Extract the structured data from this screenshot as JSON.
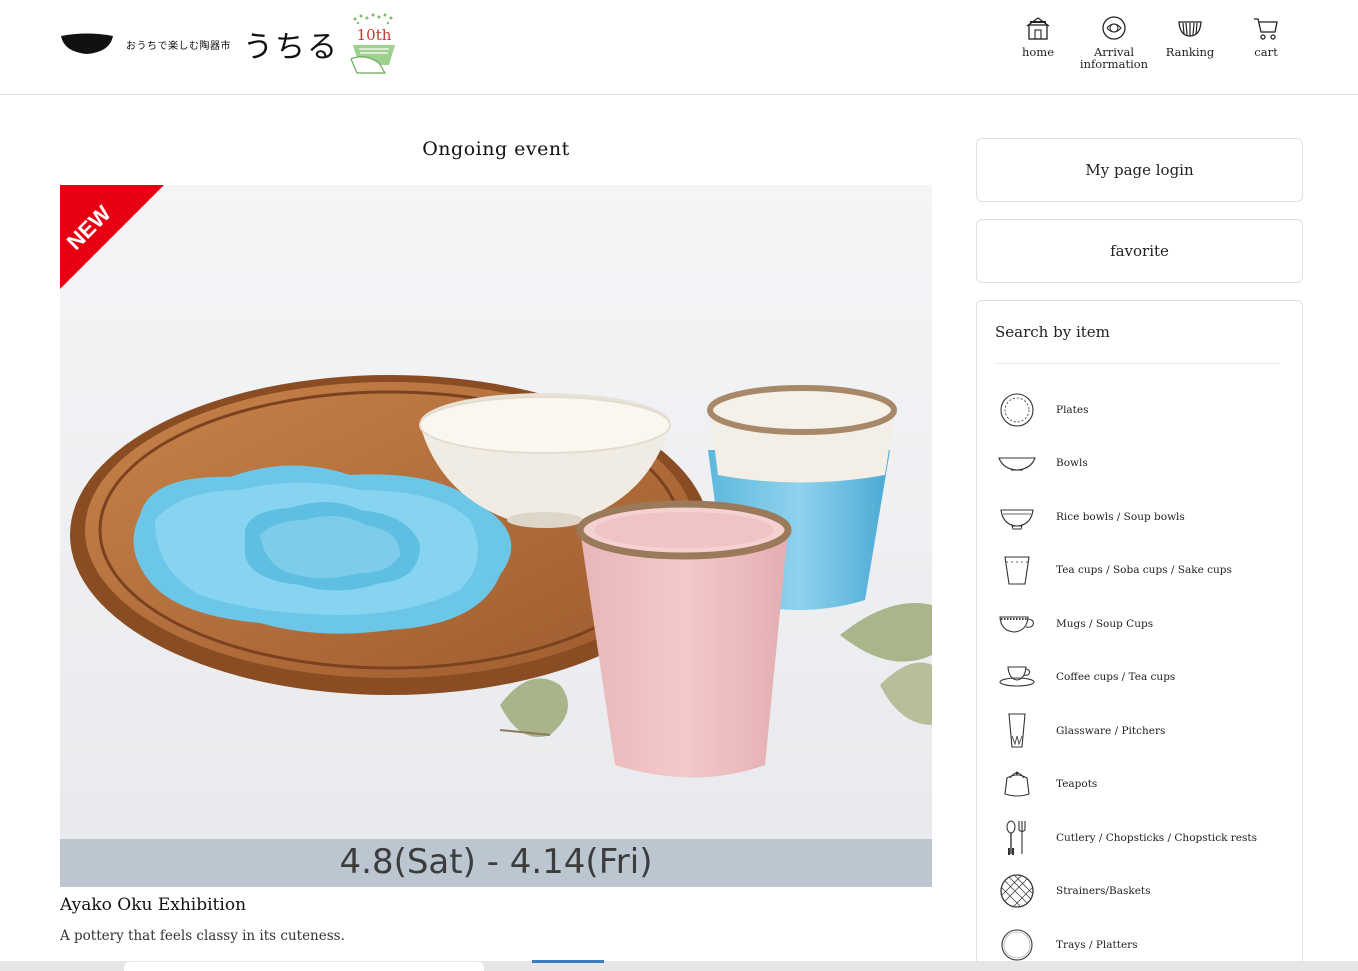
{
  "brand": {
    "tagline": "おうちで楽しむ陶器市",
    "name": "うちる",
    "anniversary": "10th"
  },
  "nav": [
    {
      "label": "home",
      "icon": "home-icon"
    },
    {
      "label": "Arrival information",
      "icon": "arrival-icon"
    },
    {
      "label": "Ranking",
      "icon": "ranking-icon"
    },
    {
      "label": "cart",
      "icon": "cart-icon"
    }
  ],
  "event": {
    "section_title": "Ongoing event",
    "ribbon": "NEW",
    "dates": "4.8(Sat) - 4.14(Fri)",
    "name": "Ayako Oku Exhibition",
    "description": "A pottery that feels classy in its cuteness."
  },
  "sidebar": {
    "login_label": "My page login",
    "favorite_label": "favorite",
    "search_title": "Search by item",
    "categories": [
      {
        "label": "Plates",
        "icon": "plate-icon"
      },
      {
        "label": "Bowls",
        "icon": "bowl-icon"
      },
      {
        "label": "Rice bowls / Soup bowls",
        "icon": "rice-bowl-icon"
      },
      {
        "label": "Tea cups / Soba cups / Sake cups",
        "icon": "tea-cup-icon"
      },
      {
        "label": "Mugs / Soup Cups",
        "icon": "mug-icon"
      },
      {
        "label": "Coffee cups / Tea cups",
        "icon": "coffee-cup-icon"
      },
      {
        "label": "Glassware / Pitchers",
        "icon": "glass-icon"
      },
      {
        "label": "Teapots",
        "icon": "teapot-icon"
      },
      {
        "label": "Cutlery / Chopsticks / Chopstick rests",
        "icon": "cutlery-icon"
      },
      {
        "label": "Strainers/Baskets",
        "icon": "basket-icon"
      },
      {
        "label": "Trays / Platters",
        "icon": "tray-icon"
      }
    ]
  },
  "colors": {
    "ribbon": "#e60012",
    "date_bar": "#bcc6d0",
    "border": "#e0e0e0"
  }
}
